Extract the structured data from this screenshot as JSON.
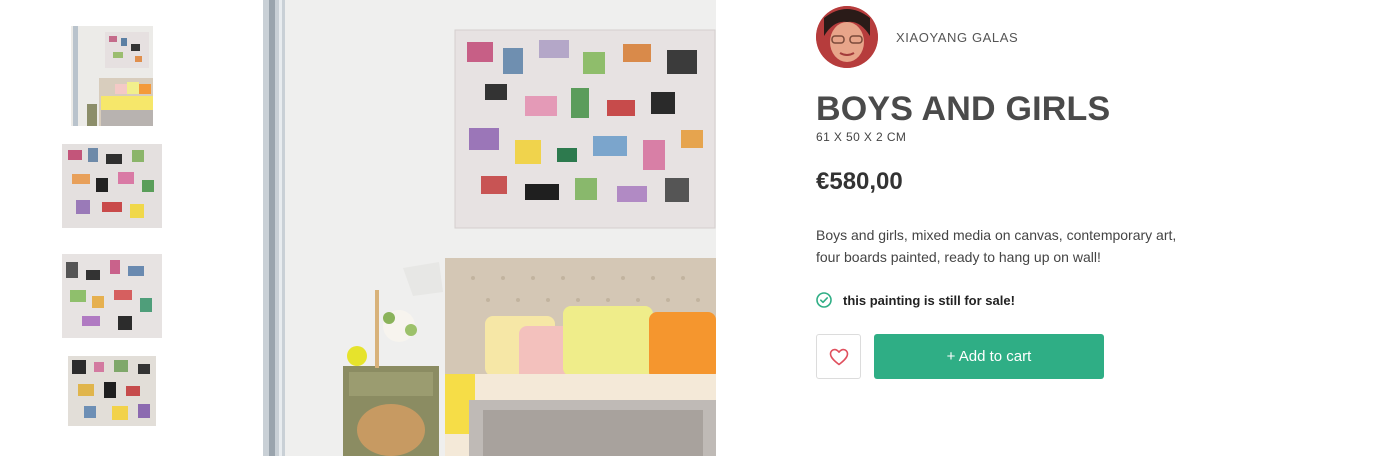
{
  "artist": {
    "name": "XIAOYANG GALAS"
  },
  "product": {
    "title": "BOYS AND GIRLS",
    "dimensions": "61 X 50 X 2 CM",
    "price": "€580,00",
    "description": "Boys and girls, mixed media on canvas, contemporary art, four boards painted, ready to hang up on wall!",
    "availability": "this painting is still for sale!"
  },
  "actions": {
    "wishlist_icon": "heart-icon",
    "add_to_cart_label": "+ Add to cart"
  },
  "colors": {
    "accent": "#2fae85",
    "heart": "#e0505e",
    "title": "#4a4a4a"
  }
}
